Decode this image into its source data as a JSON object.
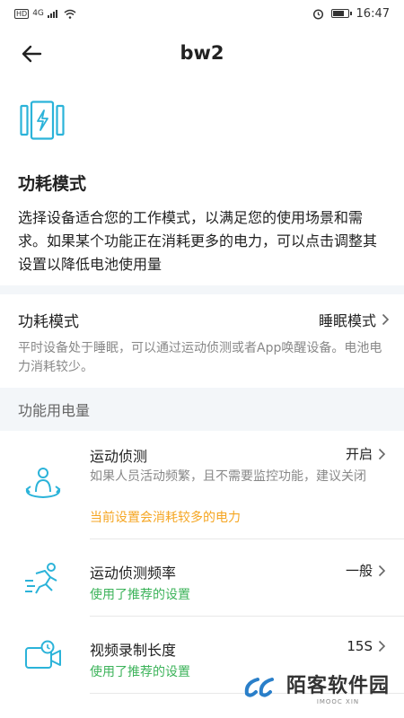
{
  "status_bar": {
    "left_badges": [
      "HD",
      "4G"
    ],
    "time": "16:47"
  },
  "nav": {
    "title": "bw2"
  },
  "intro": {
    "title": "功耗模式",
    "description": "选择设备适合您的工作模式，以满足您的使用场景和需求。如果某个功能正在消耗更多的电力，可以点击调整其设置以降低电池使用量"
  },
  "power_mode": {
    "label": "功耗模式",
    "value": "睡眠模式",
    "note": "平时设备处于睡眠，可以通过运动侦测或者App唤醒设备。电池电力消耗较少。"
  },
  "features_header": "功能用电量",
  "features": [
    {
      "name": "运动侦测",
      "value": "开启",
      "description": "如果人员活动频繁，且不需要监控功能，建议关闭",
      "status": "当前设置会消耗较多的电力",
      "status_color": "#f5a623"
    },
    {
      "name": "运动侦测频率",
      "value": "一般",
      "description": "",
      "status": "使用了推荐的设置",
      "status_color": "#3cb35a"
    },
    {
      "name": "视频录制长度",
      "value": "15S",
      "description": "",
      "status": "使用了推荐的设置",
      "status_color": "#3cb35a"
    }
  ],
  "colors": {
    "accent": "#2bb3d9",
    "warning": "#f5a623",
    "ok": "#3cb35a"
  },
  "watermark": {
    "main": "陌客软件园",
    "sub": "IMOOC XIN"
  }
}
